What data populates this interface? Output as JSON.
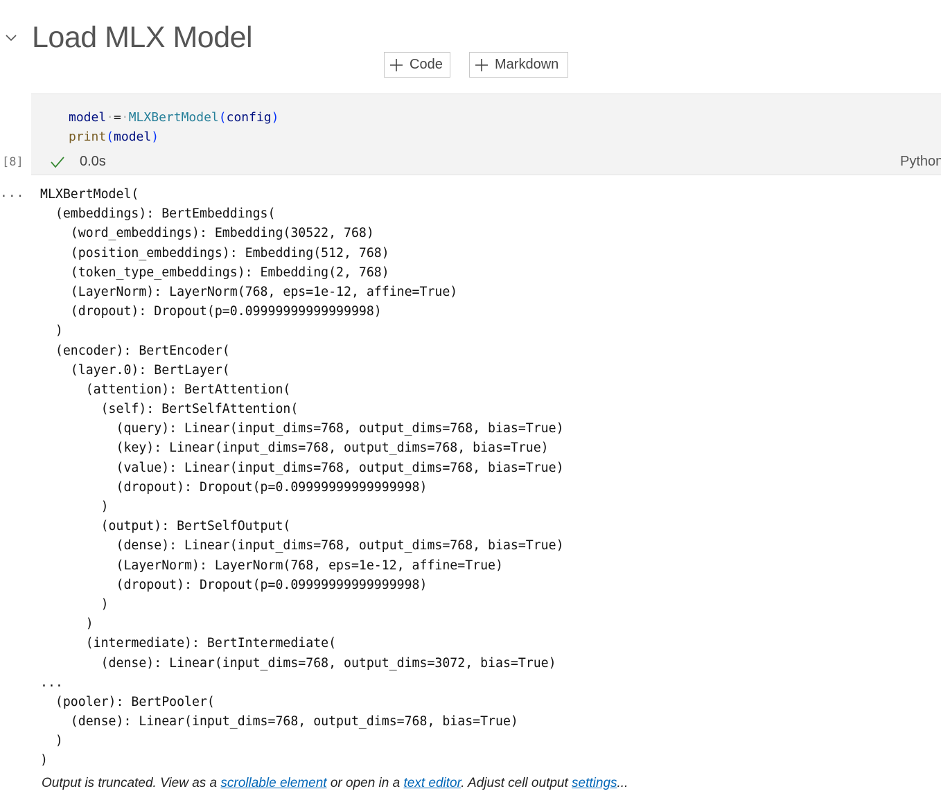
{
  "section": {
    "title": "Load MLX Model"
  },
  "toolbar": {
    "add_code_label": "Code",
    "add_markdown_label": "Markdown"
  },
  "cell": {
    "code_lines": [
      [
        {
          "t": "model",
          "c": "tok-var"
        },
        {
          "t": "·",
          "c": "tok-dot"
        },
        {
          "t": "=",
          "c": "tok-op"
        },
        {
          "t": "·",
          "c": "tok-dot"
        },
        {
          "t": "MLXBertModel",
          "c": "tok-class"
        },
        {
          "t": "(",
          "c": "tok-paren"
        },
        {
          "t": "config",
          "c": "tok-var"
        },
        {
          "t": ")",
          "c": "tok-paren"
        }
      ],
      [
        {
          "t": "print",
          "c": "tok-func"
        },
        {
          "t": "(",
          "c": "tok-paren"
        },
        {
          "t": "model",
          "c": "tok-var"
        },
        {
          "t": ")",
          "c": "tok-paren"
        }
      ]
    ],
    "execution_count": "[8]",
    "exec_time": "0.0s",
    "language": "Python"
  },
  "output": {
    "menu_label": "...",
    "lines": [
      "MLXBertModel(",
      "  (embeddings): BertEmbeddings(",
      "    (word_embeddings): Embedding(30522, 768)",
      "    (position_embeddings): Embedding(512, 768)",
      "    (token_type_embeddings): Embedding(2, 768)",
      "    (LayerNorm): LayerNorm(768, eps=1e-12, affine=True)",
      "    (dropout): Dropout(p=0.09999999999999998)",
      "  )",
      "  (encoder): BertEncoder(",
      "    (layer.0): BertLayer(",
      "      (attention): BertAttention(",
      "        (self): BertSelfAttention(",
      "          (query): Linear(input_dims=768, output_dims=768, bias=True)",
      "          (key): Linear(input_dims=768, output_dims=768, bias=True)",
      "          (value): Linear(input_dims=768, output_dims=768, bias=True)",
      "          (dropout): Dropout(p=0.09999999999999998)",
      "        )",
      "        (output): BertSelfOutput(",
      "          (dense): Linear(input_dims=768, output_dims=768, bias=True)",
      "          (LayerNorm): LayerNorm(768, eps=1e-12, affine=True)",
      "          (dropout): Dropout(p=0.09999999999999998)",
      "        )",
      "      )",
      "      (intermediate): BertIntermediate(",
      "        (dense): Linear(input_dims=768, output_dims=3072, bias=True)",
      "...",
      "  (pooler): BertPooler(",
      "    (dense): Linear(input_dims=768, output_dims=768, bias=True)",
      "  )",
      ")"
    ],
    "truncation": {
      "prefix": "Output is truncated. View as a ",
      "link1": "scrollable element",
      "middle": " or open in a ",
      "link2": "text editor",
      "middle2": ". Adjust cell output ",
      "link3": "settings",
      "suffix": "..."
    }
  },
  "icons": {
    "chevron": "chevron-down-icon",
    "plus": "plus-icon",
    "check": "check-icon"
  },
  "colors": {
    "cell_background": "#f3f3f3",
    "link": "#0066b8",
    "success_check": "#388a34"
  }
}
